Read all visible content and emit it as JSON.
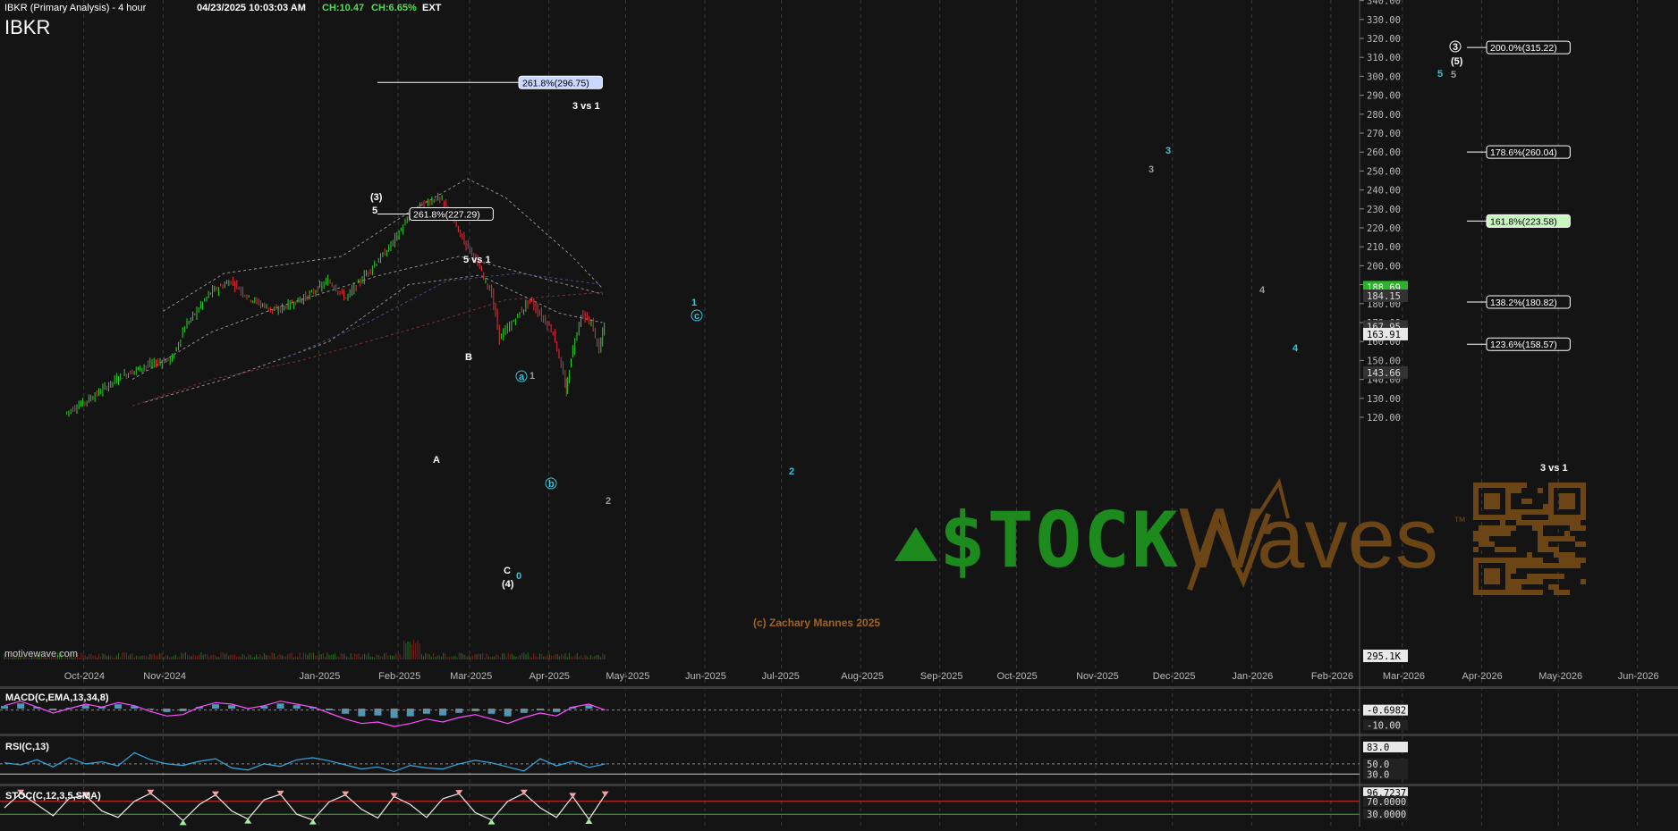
{
  "header": {
    "title": "IBKR (Primary Analysis) - 4 hour",
    "timestamp": "04/23/2025 10:03:03 AM",
    "change_abs": "CH:10.47",
    "change_pct": "CH:6.65%",
    "session": "EXT",
    "symbol": "IBKR"
  },
  "watermark": "motivewave.com",
  "copyright": "(c) Zachary Mannes 2025",
  "logo": {
    "stock_text": "$TOCK",
    "waves_text": "Waves",
    "tm": "™"
  },
  "colors": {
    "bg": "#141414",
    "up": "#2bd12b",
    "down": "#e0303a",
    "wave_white": "#ffffff",
    "wave_cyan": "#38c4d8",
    "wave_gray": "#9a9a9a",
    "fib_green": "#c9f7c0",
    "macd_line": "#ff4dff",
    "macd_hist": "#5fb8e0",
    "rsi": "#35a7e0",
    "stoch": "#f4e9e9",
    "stoch_high": "#e03030",
    "stoch_low": "#28c028",
    "logo_green": "#1d8a1d",
    "logo_brown": "#6b4516"
  },
  "icons": {
    "buy_signal": "green-triangle-up-icon",
    "qr": "qr-code-icon"
  },
  "chart_data": [
    {
      "type": "candlestick",
      "title": "IBKR (Primary Analysis) - 4 hour",
      "x_labels": [
        "Oct-2024",
        "Nov-2024",
        "Jan-2025",
        "Feb-2025",
        "Mar-2025",
        "Apr-2025",
        "May-2025",
        "Jun-2025",
        "Jul-2025",
        "Aug-2025",
        "Sep-2025",
        "Oct-2025",
        "Nov-2025",
        "Dec-2025",
        "Jan-2026",
        "Feb-2026",
        "Mar-2026",
        "Apr-2026",
        "May-2026",
        "Jun-2026"
      ],
      "y_ticks": [
        120,
        130,
        140,
        150,
        160,
        170,
        180,
        190,
        200,
        210,
        220,
        230,
        240,
        250,
        260,
        270,
        280,
        290,
        300,
        310,
        320,
        330,
        340
      ],
      "ylim": [
        113,
        345
      ],
      "grid": true,
      "price_path": [
        {
          "date": "2024-09-24",
          "price": 122
        },
        {
          "date": "2024-10-05",
          "price": 131
        },
        {
          "date": "2024-10-15",
          "price": 141
        },
        {
          "date": "2024-10-25",
          "price": 147
        },
        {
          "date": "2024-11-05",
          "price": 151
        },
        {
          "date": "2024-11-10",
          "price": 168
        },
        {
          "date": "2024-11-20",
          "price": 186
        },
        {
          "date": "2024-11-28",
          "price": 192
        },
        {
          "date": "2024-12-05",
          "price": 183
        },
        {
          "date": "2024-12-15",
          "price": 176
        },
        {
          "date": "2024-12-28",
          "price": 184
        },
        {
          "date": "2025-01-05",
          "price": 192
        },
        {
          "date": "2025-01-12",
          "price": 183
        },
        {
          "date": "2025-01-20",
          "price": 196
        },
        {
          "date": "2025-01-28",
          "price": 208
        },
        {
          "date": "2025-02-05",
          "price": 224
        },
        {
          "date": "2025-02-10",
          "price": 232
        },
        {
          "date": "2025-02-17",
          "price": 236
        },
        {
          "date": "2025-02-21",
          "price": 230
        },
        {
          "date": "2025-02-25",
          "price": 218
        },
        {
          "date": "2025-03-03",
          "price": 205
        },
        {
          "date": "2025-03-10",
          "price": 185
        },
        {
          "date": "2025-03-13",
          "price": 162
        },
        {
          "date": "2025-03-17",
          "price": 168
        },
        {
          "date": "2025-03-25",
          "price": 182
        },
        {
          "date": "2025-03-28",
          "price": 176
        },
        {
          "date": "2025-04-03",
          "price": 165
        },
        {
          "date": "2025-04-07",
          "price": 142
        },
        {
          "date": "2025-04-08",
          "price": 133
        },
        {
          "date": "2025-04-10",
          "price": 152
        },
        {
          "date": "2025-04-14",
          "price": 174
        },
        {
          "date": "2025-04-18",
          "price": 170
        },
        {
          "date": "2025-04-21",
          "price": 155
        },
        {
          "date": "2025-04-23",
          "price": 169
        }
      ],
      "price_tags": [
        "188.69",
        "184.15",
        "167.95",
        "163.91",
        "143.66",
        "295.1K"
      ],
      "fib_levels": [
        {
          "label": "261.8%(296.75)",
          "highlight": "blue"
        },
        {
          "label": "261.8%(227.29)",
          "highlight": "none"
        },
        {
          "label": "200.0%(315.22)",
          "highlight": "none"
        },
        {
          "label": "178.6%(260.04)",
          "highlight": "none"
        },
        {
          "label": "161.8%(223.58)",
          "highlight": "green"
        },
        {
          "label": "138.2%(180.82)",
          "highlight": "none"
        },
        {
          "label": "123.6%(158.57)",
          "highlight": "none"
        }
      ],
      "annotations": [
        "3 vs 1",
        "5 vs 1",
        "3 vs 1"
      ],
      "wave_labels": [
        {
          "text": "(3)",
          "color": "white"
        },
        {
          "text": "5",
          "color": "white"
        },
        {
          "text": "B",
          "color": "white"
        },
        {
          "text": "A",
          "color": "white"
        },
        {
          "text": "C",
          "color": "white"
        },
        {
          "text": "(4)",
          "color": "white"
        },
        {
          "text": "0",
          "color": "cyan"
        },
        {
          "text": "a",
          "color": "cyan"
        },
        {
          "text": "1",
          "color": "gray"
        },
        {
          "text": "b",
          "color": "cyan"
        },
        {
          "text": "2",
          "color": "gray"
        },
        {
          "text": "1",
          "color": "cyan"
        },
        {
          "text": "c",
          "color": "cyan"
        },
        {
          "text": "2",
          "color": "cyan"
        },
        {
          "text": "3",
          "color": "gray"
        },
        {
          "text": "3",
          "color": "cyan"
        },
        {
          "text": "4",
          "color": "gray"
        },
        {
          "text": "4",
          "color": "cyan"
        },
        {
          "text": "5",
          "color": "cyan"
        },
        {
          "text": "3",
          "color": "white"
        },
        {
          "text": "(5)",
          "color": "white"
        },
        {
          "text": "5",
          "color": "gray"
        }
      ],
      "volume_scale_label": "295.1K"
    },
    {
      "type": "line",
      "title": "MACD(C,EMA,13,34,8)",
      "y_ticks": [
        "-0.6982",
        "-10.00"
      ],
      "series": [
        {
          "values": [
            3,
            6,
            2,
            -2,
            1,
            4,
            2,
            5,
            3,
            -1,
            -4,
            -3,
            2,
            5,
            4,
            1,
            3,
            6,
            4,
            2,
            -2,
            -6,
            -9,
            -8,
            -11,
            -9,
            -6,
            -8,
            -5,
            -3,
            -6,
            -9,
            -5,
            -2,
            -4,
            2,
            4,
            0
          ]
        }
      ]
    },
    {
      "type": "line",
      "title": "RSI(C,13)",
      "y_ticks": [
        "83.0",
        "50.0",
        "30.0"
      ],
      "reference_lines": [
        50,
        30
      ],
      "series": [
        {
          "values": [
            52,
            48,
            58,
            44,
            62,
            50,
            54,
            46,
            72,
            58,
            50,
            47,
            55,
            60,
            42,
            38,
            50,
            45,
            58,
            62,
            56,
            48,
            40,
            44,
            35,
            47,
            42,
            40,
            50,
            57,
            52,
            44,
            36,
            60,
            46,
            55,
            43,
            50
          ]
        }
      ]
    },
    {
      "type": "line",
      "title": "STOC(C,12,3,5,SMA)",
      "y_ticks": [
        "96.7237",
        "70.0000",
        "30.0000"
      ],
      "reference_lines": [
        70,
        30
      ],
      "series": [
        {
          "values": [
            50,
            95,
            60,
            25,
            80,
            88,
            40,
            20,
            70,
            95,
            55,
            10,
            60,
            90,
            40,
            15,
            75,
            92,
            30,
            12,
            68,
            90,
            45,
            18,
            85,
            60,
            20,
            78,
            94,
            35,
            12,
            70,
            95,
            50,
            20,
            85,
            14,
            90
          ]
        }
      ]
    }
  ]
}
